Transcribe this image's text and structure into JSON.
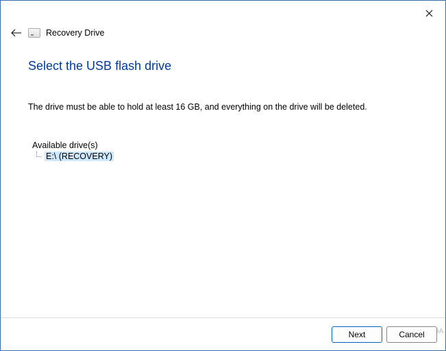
{
  "wizard": {
    "title": "Recovery Drive"
  },
  "page": {
    "heading": "Select the USB flash drive",
    "description": "The drive must be able to hold at least 16 GB, and everything on the drive will be deleted."
  },
  "drives": {
    "label": "Available drive(s)",
    "items": [
      {
        "name": "E:\\ (RECOVERY)"
      }
    ]
  },
  "buttons": {
    "next": "Next",
    "cancel": "Cancel"
  },
  "watermark": "XDA"
}
